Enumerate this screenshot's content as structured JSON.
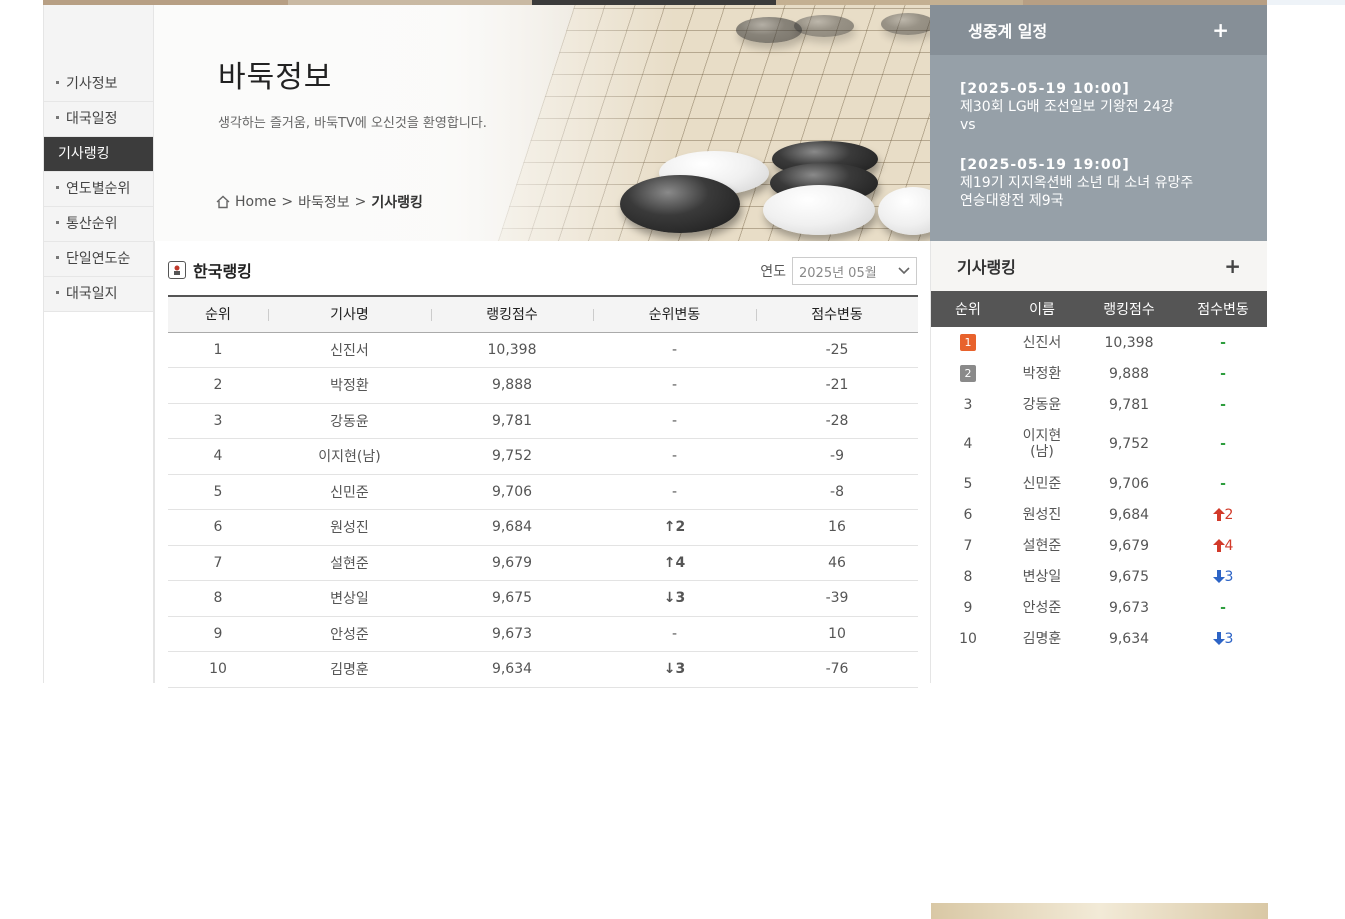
{
  "sidebar": {
    "items": [
      {
        "label": "기사정보",
        "type": "item"
      },
      {
        "label": "대국일정",
        "type": "item"
      },
      {
        "label": "기사랭킹",
        "type": "section"
      },
      {
        "label": "연도별순위",
        "type": "item"
      },
      {
        "label": "통산순위",
        "type": "item"
      },
      {
        "label": "단일연도순",
        "type": "item"
      },
      {
        "label": "대국일지",
        "type": "item"
      }
    ]
  },
  "hero": {
    "title": "바둑정보",
    "subtitle": "생각하는 즐거움, 바둑TV에 오신것을 환영합니다.",
    "breadcrumb": [
      "Home",
      "바둑정보",
      "기사랭킹"
    ]
  },
  "ranking": {
    "title": "한국랭킹",
    "year_label": "연도",
    "year_value": "2025년 05월",
    "headers": [
      "순위",
      "기사명",
      "랭킹점수",
      "순위변동",
      "점수변동"
    ],
    "rows": [
      {
        "rank": "1",
        "name": "신진서",
        "score": "10,398",
        "change": "-",
        "dir": "none",
        "delta": "-25"
      },
      {
        "rank": "2",
        "name": "박정환",
        "score": "9,888",
        "change": "-",
        "dir": "none",
        "delta": "-21"
      },
      {
        "rank": "3",
        "name": "강동윤",
        "score": "9,781",
        "change": "-",
        "dir": "none",
        "delta": "-28"
      },
      {
        "rank": "4",
        "name": "이지현(남)",
        "score": "9,752",
        "change": "-",
        "dir": "none",
        "delta": "-9"
      },
      {
        "rank": "5",
        "name": "신민준",
        "score": "9,706",
        "change": "-",
        "dir": "none",
        "delta": "-8"
      },
      {
        "rank": "6",
        "name": "원성진",
        "score": "9,684",
        "change": "↑2",
        "dir": "up",
        "delta": "16"
      },
      {
        "rank": "7",
        "name": "설현준",
        "score": "9,679",
        "change": "↑4",
        "dir": "up",
        "delta": "46"
      },
      {
        "rank": "8",
        "name": "변상일",
        "score": "9,675",
        "change": "↓3",
        "dir": "down",
        "delta": "-39"
      },
      {
        "rank": "9",
        "name": "안성준",
        "score": "9,673",
        "change": "-",
        "dir": "none",
        "delta": "10"
      },
      {
        "rank": "10",
        "name": "김명훈",
        "score": "9,634",
        "change": "↓3",
        "dir": "down",
        "delta": "-76"
      }
    ]
  },
  "schedule": {
    "title": "생중계 일정",
    "plus": "+",
    "events": [
      {
        "datetime": "[2025-05-19   10:00]",
        "line1": "제30회 LG배 조선일보 기왕전 24강",
        "line2": "vs"
      },
      {
        "datetime": "[2025-05-19   19:00]",
        "line1": "제19기 지지옥션배 소년 대 소녀 유망주",
        "line2": "연승대항전 제9국"
      }
    ]
  },
  "side_ranking": {
    "title": "기사랭킹",
    "plus": "+",
    "headers": [
      "순위",
      "이름",
      "랭킹점수",
      "점수변동"
    ],
    "rows": [
      {
        "rank": "1",
        "name": "신진서",
        "score": "10,398",
        "change": "-",
        "dir": "none"
      },
      {
        "rank": "2",
        "name": "박정환",
        "score": "9,888",
        "change": "-",
        "dir": "none"
      },
      {
        "rank": "3",
        "name": "강동윤",
        "score": "9,781",
        "change": "-",
        "dir": "none"
      },
      {
        "rank": "4",
        "name": "이지현\n(남)",
        "score": "9,752",
        "change": "-",
        "dir": "none"
      },
      {
        "rank": "5",
        "name": "신민준",
        "score": "9,706",
        "change": "-",
        "dir": "none"
      },
      {
        "rank": "6",
        "name": "원성진",
        "score": "9,684",
        "change": "2",
        "dir": "up"
      },
      {
        "rank": "7",
        "name": "설현준",
        "score": "9,679",
        "change": "4",
        "dir": "up"
      },
      {
        "rank": "8",
        "name": "변상일",
        "score": "9,675",
        "change": "3",
        "dir": "down"
      },
      {
        "rank": "9",
        "name": "안성준",
        "score": "9,673",
        "change": "-",
        "dir": "none"
      },
      {
        "rank": "10",
        "name": "김명훈",
        "score": "9,634",
        "change": "3",
        "dir": "down"
      }
    ]
  },
  "colors": {
    "section_bg": "#3c3c3c",
    "schedule_bg": "#96a0a8",
    "up": "#c0392b",
    "down": "#2d64c6",
    "flat": "#2e9e3e",
    "badge_first": "#e8622c"
  }
}
